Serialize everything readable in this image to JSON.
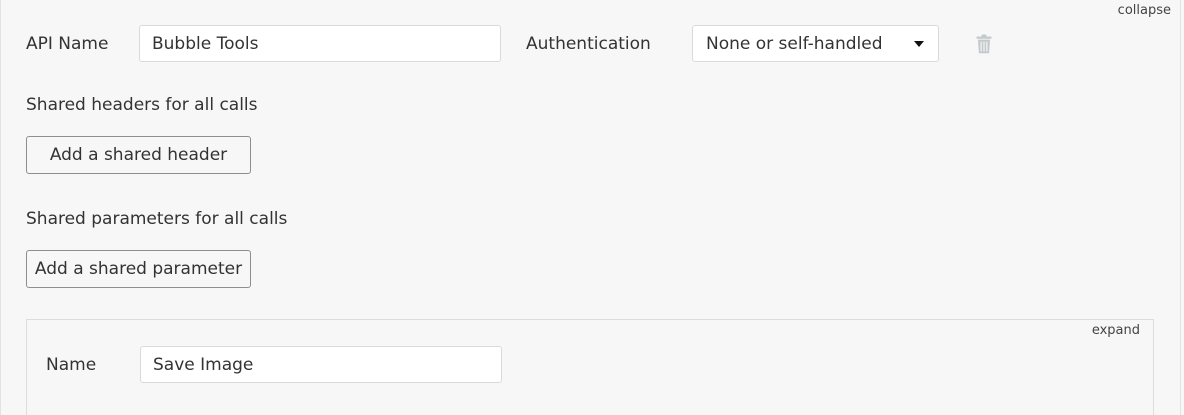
{
  "api": {
    "collapse_label": "collapse",
    "name_label": "API Name",
    "name_value": "Bubble Tools",
    "auth_label": "Authentication",
    "auth_selected": "None or self-handled",
    "delete_icon": "trash-icon"
  },
  "shared_headers": {
    "heading": "Shared headers for all calls",
    "add_button": "Add a shared header"
  },
  "shared_params": {
    "heading": "Shared parameters for all calls",
    "add_button": "Add a shared parameter"
  },
  "call": {
    "expand_label": "expand",
    "name_label": "Name",
    "name_value": "Save Image"
  },
  "colors": {
    "background": "#f7f7f7",
    "input_border": "#dadada",
    "button_border": "#8e8e8e",
    "trash_icon": "#c4c9cc"
  }
}
